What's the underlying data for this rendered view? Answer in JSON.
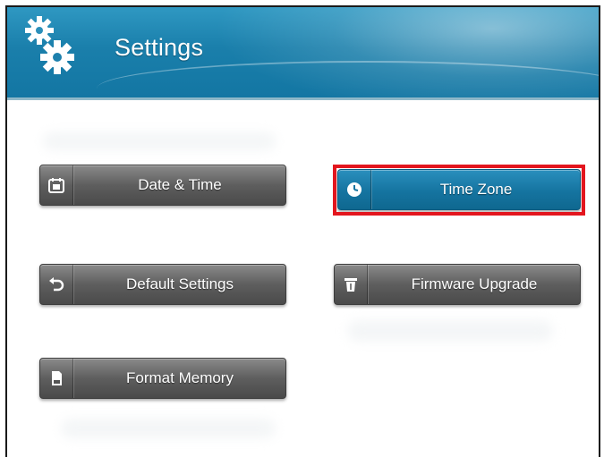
{
  "header": {
    "title": "Settings",
    "icon": "gears-icon"
  },
  "buttons": [
    {
      "id": "date-time",
      "label": "Date & Time",
      "icon": "calendar-icon",
      "active": false
    },
    {
      "id": "time-zone",
      "label": "Time Zone",
      "icon": "clock-icon",
      "active": true
    },
    {
      "id": "default-settings",
      "label": "Default Settings",
      "icon": "undo-icon",
      "active": false
    },
    {
      "id": "firmware-upgrade",
      "label": "Firmware Upgrade",
      "icon": "trash-icon",
      "active": false
    },
    {
      "id": "format-memory",
      "label": "Format Memory",
      "icon": "sd-card-icon",
      "active": false
    }
  ],
  "colors": {
    "header": "#1a7fab",
    "button": "#5e5e5e",
    "active_button": "#1574a0",
    "highlight": "#e3161e"
  }
}
